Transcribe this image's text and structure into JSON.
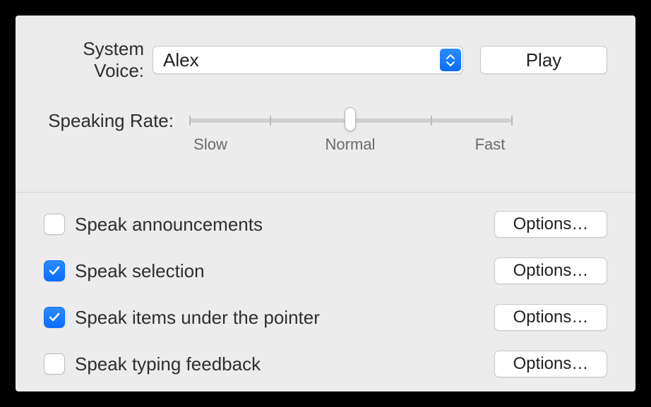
{
  "voice": {
    "label": "System Voice:",
    "selected": "Alex",
    "play_label": "Play"
  },
  "rate": {
    "label": "Speaking Rate:",
    "slow": "Slow",
    "normal": "Normal",
    "fast": "Fast",
    "value_percent": 50
  },
  "items": [
    {
      "label": "Speak announcements",
      "checked": false,
      "options_label": "Options…"
    },
    {
      "label": "Speak selection",
      "checked": true,
      "options_label": "Options…"
    },
    {
      "label": "Speak items under the pointer",
      "checked": true,
      "options_label": "Options…"
    },
    {
      "label": "Speak typing feedback",
      "checked": false,
      "options_label": "Options…"
    }
  ]
}
